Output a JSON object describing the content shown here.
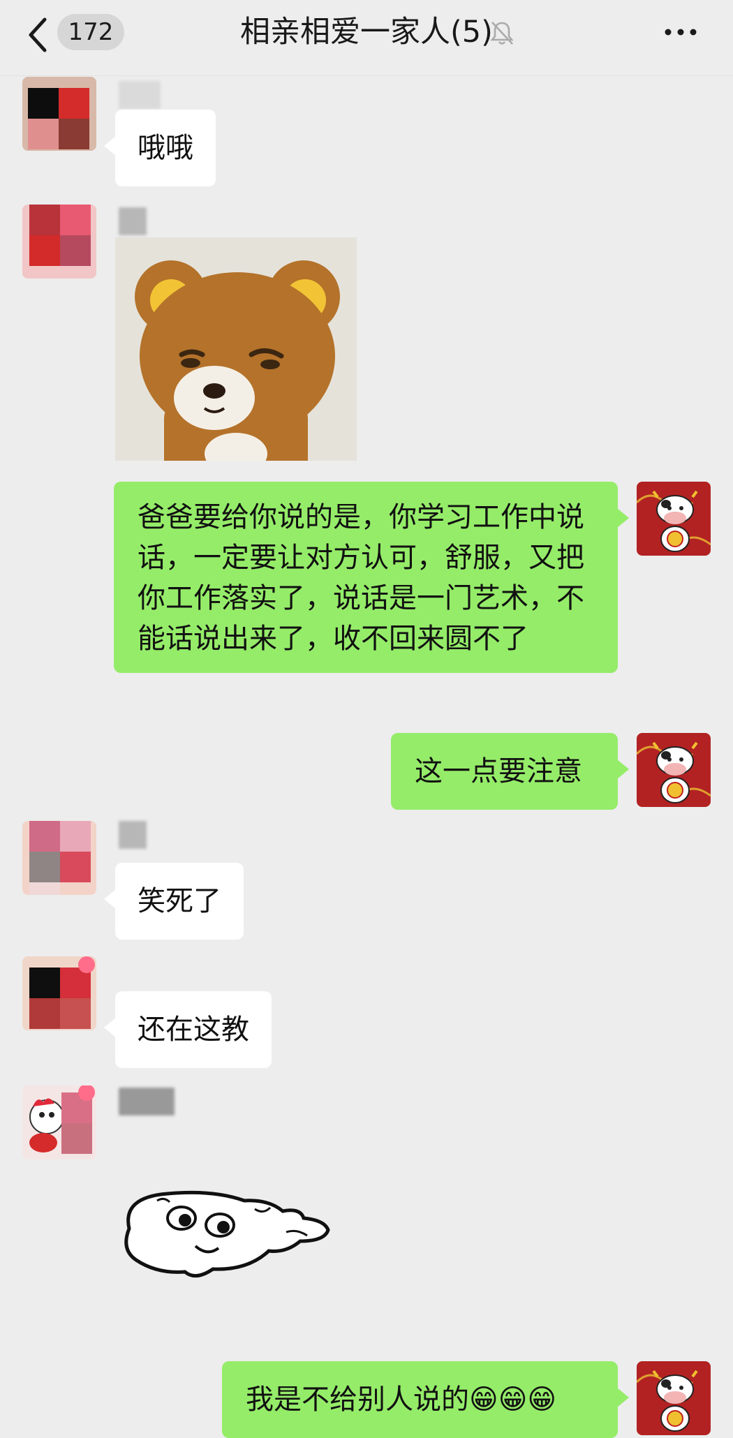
{
  "header": {
    "unread_count": "172",
    "title": "相亲相爱一家人(5)",
    "back_icon": "chevron-left-icon",
    "mute_icon": "bell-muted-icon",
    "more_icon": "more-dots-icon"
  },
  "messages": [
    {
      "side": "left",
      "text": "哦哦"
    },
    {
      "side": "left",
      "sticker": "bear-sticker"
    },
    {
      "side": "right",
      "text": "爸爸要给你说的是，你学习工作中说话，一定要让对方认可，舒服，又把你工作落实了，说话是一门艺术，不能话说出来了，收不回来圆不了"
    },
    {
      "side": "right",
      "text": "这一点要注意"
    },
    {
      "side": "left",
      "text": "笑死了"
    },
    {
      "side": "left",
      "text": "还在这教"
    },
    {
      "side": "left",
      "sticker": "cartoon-face-sticker"
    },
    {
      "side": "right",
      "text": "我是不给别人说的😁😁😁"
    }
  ],
  "colors": {
    "background": "#ededed",
    "incoming_bubble": "#ffffff",
    "outgoing_bubble": "#95ec69"
  }
}
